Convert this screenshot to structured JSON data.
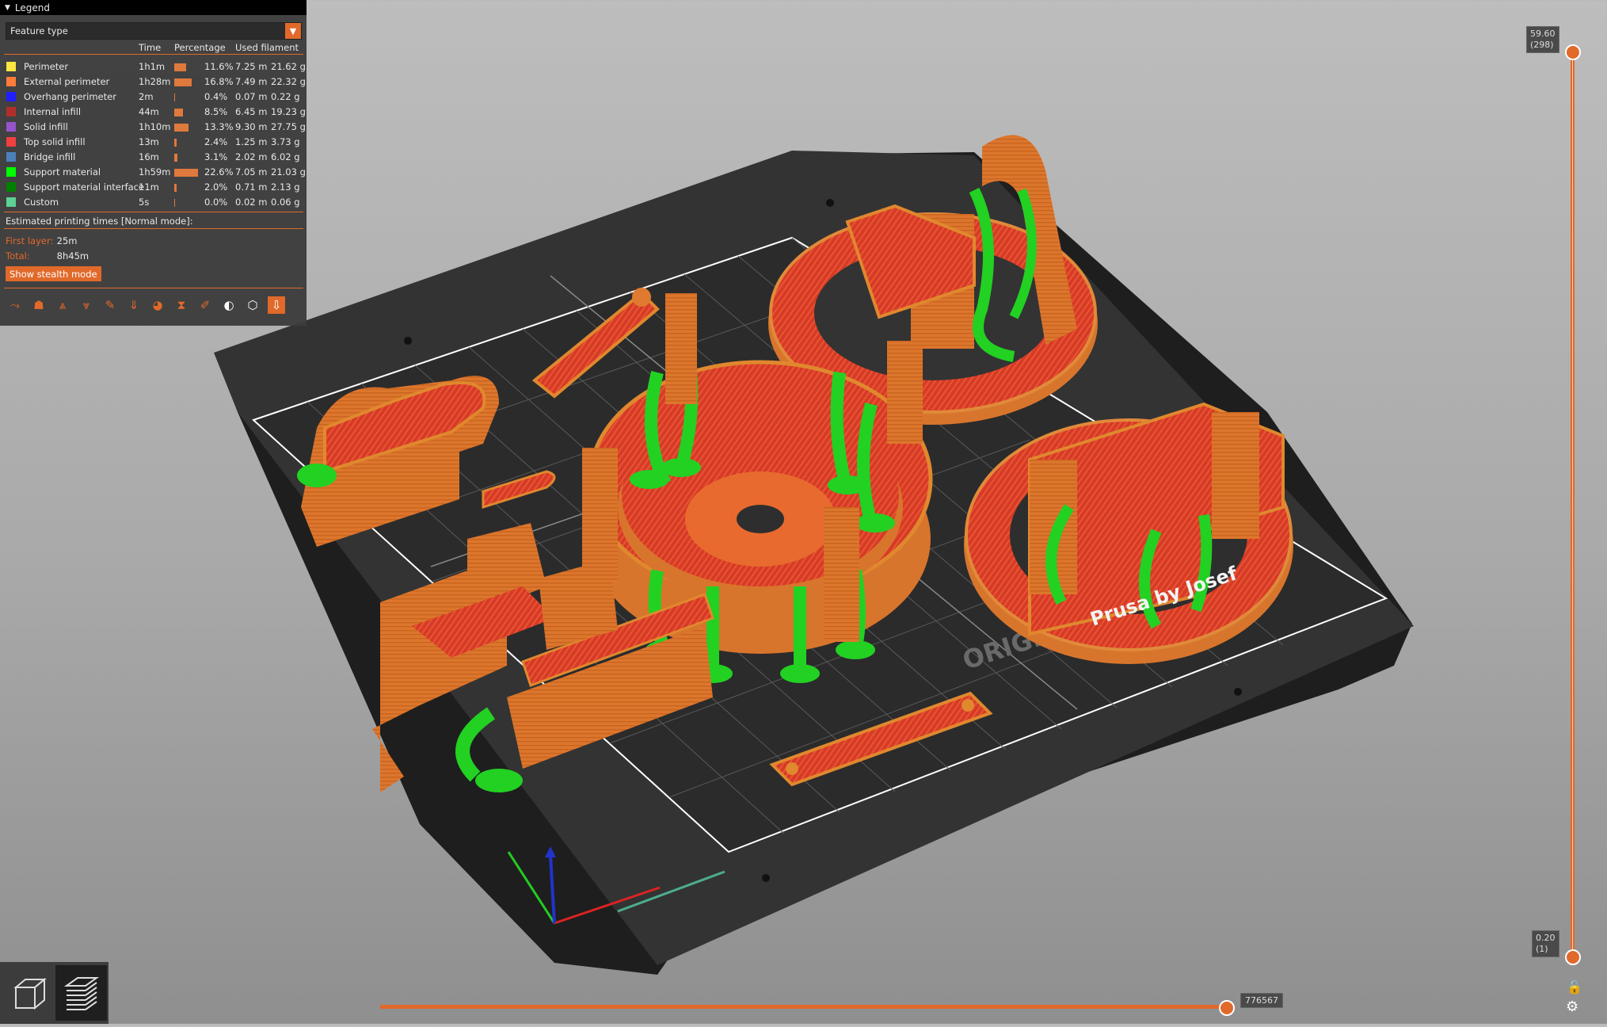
{
  "legend": {
    "title": "Legend",
    "view_type": "Feature type",
    "columns": {
      "time": "Time",
      "percentage": "Percentage",
      "used_filament": "Used filament"
    },
    "rows": [
      {
        "name": "Perimeter",
        "time": "1h1m",
        "pct": "11.6%",
        "len": "7.25 m",
        "wt": "21.62 g",
        "color": "#ffe640",
        "fraction": 0.116
      },
      {
        "name": "External perimeter",
        "time": "1h28m",
        "pct": "16.8%",
        "len": "7.49 m",
        "wt": "22.32 g",
        "color": "#ff7d38",
        "fraction": 0.168
      },
      {
        "name": "Overhang perimeter",
        "time": "2m",
        "pct": "0.4%",
        "len": "0.07 m",
        "wt": "0.22 g",
        "color": "#1f1fff",
        "fraction": 0.004
      },
      {
        "name": "Internal infill",
        "time": "44m",
        "pct": "8.5%",
        "len": "6.45 m",
        "wt": "19.23 g",
        "color": "#b03029",
        "fraction": 0.085
      },
      {
        "name": "Solid infill",
        "time": "1h10m",
        "pct": "13.3%",
        "len": "9.30 m",
        "wt": "27.75 g",
        "color": "#9654cc",
        "fraction": 0.133
      },
      {
        "name": "Top solid infill",
        "time": "13m",
        "pct": "2.4%",
        "len": "1.25 m",
        "wt": "3.73 g",
        "color": "#f04040",
        "fraction": 0.024
      },
      {
        "name": "Bridge infill",
        "time": "16m",
        "pct": "3.1%",
        "len": "2.02 m",
        "wt": "6.02 g",
        "color": "#4d80ba",
        "fraction": 0.031
      },
      {
        "name": "Support material",
        "time": "1h59m",
        "pct": "22.6%",
        "len": "7.05 m",
        "wt": "21.03 g",
        "color": "#00ff00",
        "fraction": 0.226
      },
      {
        "name": "Support material interface",
        "time": "11m",
        "pct": "2.0%",
        "len": "0.71 m",
        "wt": "2.13 g",
        "color": "#008000",
        "fraction": 0.02
      },
      {
        "name": "Custom",
        "time": "5s",
        "pct": "0.0%",
        "len": "0.02 m",
        "wt": "0.06 g",
        "color": "#5ed194",
        "fraction": 0.0
      }
    ],
    "estimated_label": "Estimated printing times [Normal mode]:",
    "first_layer_label": "First layer:",
    "first_layer_value": "25m",
    "total_label": "Total:",
    "total_value": "8h45m",
    "stealth_button": "Show stealth mode",
    "toolbar_icons": [
      "travel-icon",
      "wipe-icon",
      "retractions-icon",
      "deretractions-icon",
      "seams-icon",
      "tool-changes-icon",
      "color-changes-icon",
      "pause-prints-icon",
      "custom-gcodes-icon",
      "center-of-gravity-icon",
      "shells-icon",
      "tool-marker-icon"
    ]
  },
  "vertical_slider": {
    "top_value": "59.60",
    "top_layer": "(298)",
    "bottom_value": "0.20",
    "bottom_layer": "(1)"
  },
  "horizontal_slider": {
    "value": "776567",
    "fraction": 0.997
  },
  "view_buttons": [
    "3d-view-icon",
    "preview-layers-icon"
  ],
  "colors": {
    "accent": "#e1692a",
    "bed": "#2f2f2f",
    "part_orange": "#e0792e",
    "part_red": "#d83a2a",
    "support_green": "#1fd11f"
  }
}
